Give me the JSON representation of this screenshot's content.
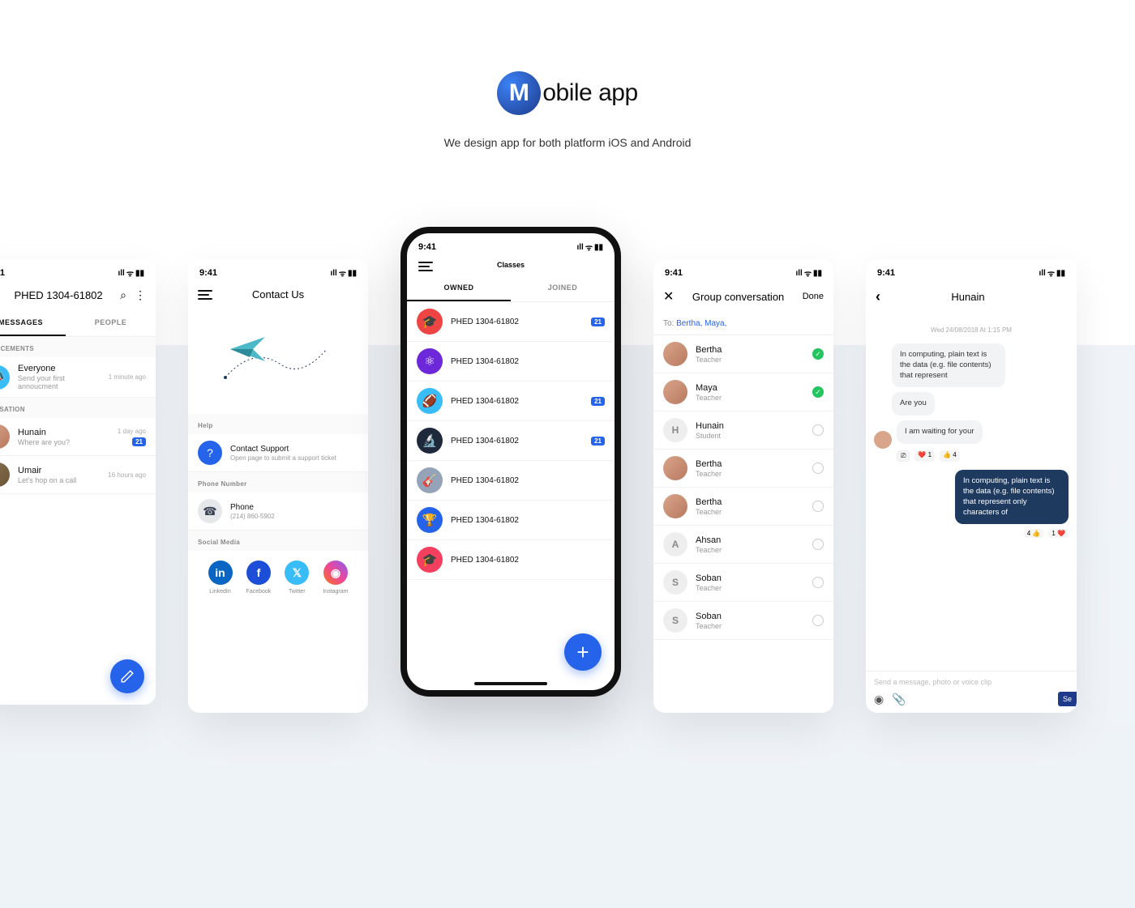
{
  "header": {
    "logo_letter": "M",
    "logo_rest": "obile app",
    "tagline": "We design app for both platform iOS and Android"
  },
  "common": {
    "time": "9:41",
    "signal": "ıll",
    "wifi": "ᯤ",
    "battery": "▮▮"
  },
  "screen1": {
    "title": "PHED 1304-61802",
    "tabs": [
      "MESSAGES",
      "PEOPLE"
    ],
    "sec1": "OUNCEMENTS",
    "ann": {
      "title": "Everyone",
      "sub": "Send your first annoucment",
      "time": "1 minute ago"
    },
    "sec2": "VERSATION",
    "conv": [
      {
        "name": "Hunain",
        "msg": "Where are you?",
        "time": "1 day ago",
        "badge": "21"
      },
      {
        "name": "Umair",
        "msg": "Let's hop on a call",
        "time": "16 hours ago"
      }
    ]
  },
  "screen2": {
    "title": "Contact Us",
    "help_label": "Help",
    "help": {
      "title": "Contact Support",
      "sub": "Open page to submit a support ticket"
    },
    "phone_label": "Phone Number",
    "phone": {
      "title": "Phone",
      "sub": "(214) 860-5902"
    },
    "social_label": "Social Media",
    "socials": [
      {
        "name": "LinkedIn",
        "glyph": "in",
        "bg": "#0a66c2"
      },
      {
        "name": "Facebook",
        "glyph": "f",
        "bg": "#1d4ed8"
      },
      {
        "name": "Twitter",
        "glyph": "𝕏",
        "bg": "#38bdf8"
      },
      {
        "name": "Instagram",
        "glyph": "◉",
        "bg": "linear-gradient(45deg,#f97316,#ec4899,#8b5cf6)"
      }
    ]
  },
  "screen3": {
    "title": "Classes",
    "tabs": [
      "OWNED",
      "JOINED"
    ],
    "items": [
      {
        "name": "PHED 1304-61802",
        "bg": "#ef4444",
        "glyph": "🎓",
        "badge": "21"
      },
      {
        "name": "PHED 1304-61802",
        "bg": "#6d28d9",
        "glyph": "⚛"
      },
      {
        "name": "PHED 1304-61802",
        "bg": "#38bdf8",
        "glyph": "🏈",
        "badge": "21"
      },
      {
        "name": "PHED 1304-61802",
        "bg": "#1e293b",
        "glyph": "🔬",
        "badge": "21"
      },
      {
        "name": "PHED 1304-61802",
        "bg": "#94a3b8",
        "glyph": "🎸"
      },
      {
        "name": "PHED 1304-61802",
        "bg": "#2563eb",
        "glyph": "🏆"
      },
      {
        "name": "PHED 1304-61802",
        "bg": "#f43f5e",
        "glyph": "🎓"
      }
    ]
  },
  "screen4": {
    "title": "Group conversation",
    "done": "Done",
    "to_label": "To:",
    "to_names": "Bertha,  Maya,",
    "people": [
      {
        "name": "Bertha",
        "role": "Teacher",
        "type": "photo",
        "sel": true
      },
      {
        "name": "Maya",
        "role": "Teacher",
        "type": "photo",
        "sel": true
      },
      {
        "name": "Hunain",
        "role": "Student",
        "type": "letter",
        "initial": "H"
      },
      {
        "name": "Bertha",
        "role": "Teacher",
        "type": "photo"
      },
      {
        "name": "Bertha",
        "role": "Teacher",
        "type": "photo"
      },
      {
        "name": "Ahsan",
        "role": "Teacher",
        "type": "letter",
        "initial": "A"
      },
      {
        "name": "Soban",
        "role": "Teacher",
        "type": "letter",
        "initial": "S"
      },
      {
        "name": "Soban",
        "role": "Teacher",
        "type": "letter",
        "initial": "S"
      }
    ]
  },
  "screen5": {
    "title": "Hunain",
    "date": "Wed 24/08/2018 At 1:15 PM",
    "msgs": {
      "m1": "In computing, plain text is the data (e.g. file contents) that represent",
      "m2": "Are you",
      "m3": "I am waiting for your",
      "m4": "In computing, plain text is the data (e.g. file contents) that represent only characters of"
    },
    "r1": [
      "❤️ 1",
      "👍 4"
    ],
    "r2": [
      "4 👍",
      "1 ❤️"
    ],
    "placeholder": "Send a message, photo or voice clip",
    "send": "Se"
  }
}
